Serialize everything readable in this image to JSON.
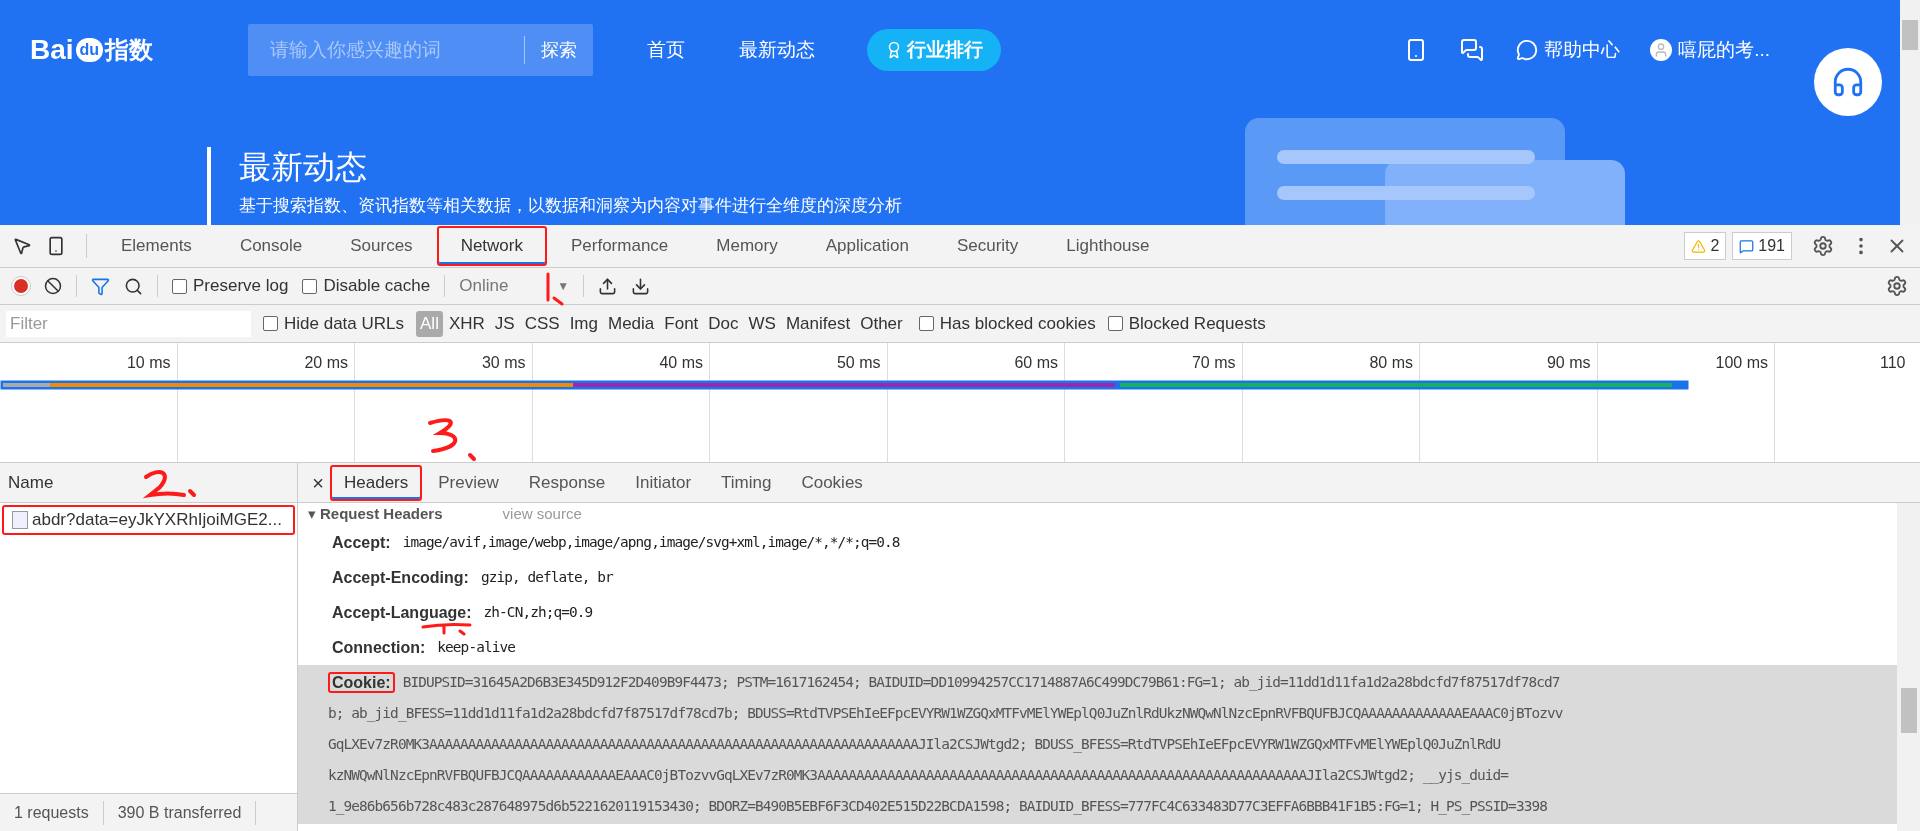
{
  "site": {
    "logo": [
      "Bai",
      "du",
      "指数"
    ],
    "search": {
      "placeholder": "请输入你感兴趣的词",
      "button": "探索"
    },
    "nav": [
      "首页",
      "最新动态"
    ],
    "rank_button": "行业排行",
    "help": "帮助中心",
    "user": "嘻屁的考...",
    "hero": {
      "title": "最新动态",
      "subtitle": "基于搜索指数、资讯指数等相关数据，以数据和洞察为内容对事件进行全维度的深度分析"
    }
  },
  "devtools": {
    "tabs": [
      {
        "label": "Elements",
        "selected": false,
        "annotated": false
      },
      {
        "label": "Console",
        "selected": false,
        "annotated": false
      },
      {
        "label": "Sources",
        "selected": false,
        "annotated": false
      },
      {
        "label": "Network",
        "selected": true,
        "annotated": true
      },
      {
        "label": "Performance",
        "selected": false,
        "annotated": false
      },
      {
        "label": "Memory",
        "selected": false,
        "annotated": false
      },
      {
        "label": "Application",
        "selected": false,
        "annotated": false
      },
      {
        "label": "Security",
        "selected": false,
        "annotated": false
      },
      {
        "label": "Lighthouse",
        "selected": false,
        "annotated": false
      }
    ],
    "warnings": "2",
    "messages": "191",
    "toolbar": {
      "recording": true,
      "options": [
        {
          "label": "Preserve log",
          "checked": false
        },
        {
          "label": "Disable cache",
          "checked": false
        }
      ],
      "throttling": "Online",
      "throttling_caret": "▼"
    },
    "filter": {
      "placeholder": "Filter",
      "hide_data_urls": {
        "label": "Hide data URLs",
        "checked": false
      },
      "types": [
        {
          "label": "All",
          "selected": true
        },
        {
          "label": "XHR",
          "selected": false
        },
        {
          "label": "JS",
          "selected": false
        },
        {
          "label": "CSS",
          "selected": false
        },
        {
          "label": "Img",
          "selected": false
        },
        {
          "label": "Media",
          "selected": false
        },
        {
          "label": "Font",
          "selected": false
        },
        {
          "label": "Doc",
          "selected": false
        },
        {
          "label": "WS",
          "selected": false
        },
        {
          "label": "Manifest",
          "selected": false
        },
        {
          "label": "Other",
          "selected": false
        }
      ],
      "extra": [
        {
          "label": "Has blocked cookies",
          "checked": false
        },
        {
          "label": "Blocked Requests",
          "checked": false
        }
      ]
    },
    "timeline_ticks": [
      "10 ms",
      "20 ms",
      "30 ms",
      "40 ms",
      "50 ms",
      "60 ms",
      "70 ms",
      "80 ms",
      "90 ms",
      "100 ms",
      "110"
    ],
    "requests": {
      "column": "Name",
      "rows": [
        {
          "name": "abdr?data=eyJkYXRhIjoiMGE2...",
          "annotated": true
        }
      ]
    },
    "detail": {
      "close": "×",
      "tabs": [
        {
          "label": "Headers",
          "selected": true,
          "annotated": true
        },
        {
          "label": "Preview",
          "selected": false,
          "annotated": false
        },
        {
          "label": "Response",
          "selected": false,
          "annotated": false
        },
        {
          "label": "Initiator",
          "selected": false,
          "annotated": false
        },
        {
          "label": "Timing",
          "selected": false,
          "annotated": false
        },
        {
          "label": "Cookies",
          "selected": false,
          "annotated": false
        }
      ],
      "section": {
        "toggle": "▾",
        "title": "Request Headers",
        "link": "view source"
      },
      "headers": [
        {
          "name": "Accept:",
          "lines": [
            "image/avif,image/webp,image/apng,image/svg+xml,image/*,*/*;q=0.8"
          ],
          "highlighted": false,
          "annotated": false
        },
        {
          "name": "Accept-Encoding:",
          "lines": [
            "gzip, deflate, br"
          ],
          "highlighted": false,
          "annotated": false
        },
        {
          "name": "Accept-Language:",
          "lines": [
            "zh-CN,zh;q=0.9"
          ],
          "highlighted": false,
          "annotated": false
        },
        {
          "name": "Connection:",
          "lines": [
            "keep-alive"
          ],
          "highlighted": false,
          "annotated": false
        },
        {
          "name": "Cookie:",
          "lines": [
            "BIDUPSID=31645A2D6B3E345D912F2D409B9F4473; PSTM=1617162454; BAIDUID=DD10994257CC1714887A6C499DC79B61:FG=1; ab_jid=11dd1d11fa1d2a28bdcfd7f87517df78cd7",
            "b; ab_jid_BFESS=11dd1d11fa1d2a28bdcfd7f87517df78cd7b; BDUSS=RtdTVPSEhIeEFpcEVYRW1WZGQxMTFvMElYWEplQ0JuZnlRdUkzNWQwNlNzcEpnRVFBQUFBJCQAAAAAAAAAAAAAEAAAC0jBTozvv",
            "GqLXEv7zR0MK3AAAAAAAAAAAAAAAAAAAAAAAAAAAAAAAAAAAAAAAAAAAAAAAAAAAAAAAAAAAAAAAJIla2CSJWtgd2; BDUSS_BFESS=RtdTVPSEhIeEFpcEVYRW1WZGQxMTFvMElYWEplQ0JuZnlRdU",
            "kzNWQwNlNzcEpnRVFBQUFBJCQAAAAAAAAAAAAEAAAC0jBTozvvGqLXEv7zR0MK3AAAAAAAAAAAAAAAAAAAAAAAAAAAAAAAAAAAAAAAAAAAAAAAAAAAAAAAAAAAAAAAJIla2CSJWtgd2; __yjs_duid=",
            "1_9e86b656b728c483c287648975d6b5221620119153430; BDORZ=B490B5EBF6F3CD402E515D22BCDA1598; BAIDUID_BFESS=777FC4C633483D77C3EFFA6BBB41F1B5:FG=1; H_PS_PSSID=3398"
          ],
          "highlighted": true,
          "annotated": true
        }
      ]
    },
    "status": [
      "1 requests",
      "390 B transferred"
    ]
  }
}
